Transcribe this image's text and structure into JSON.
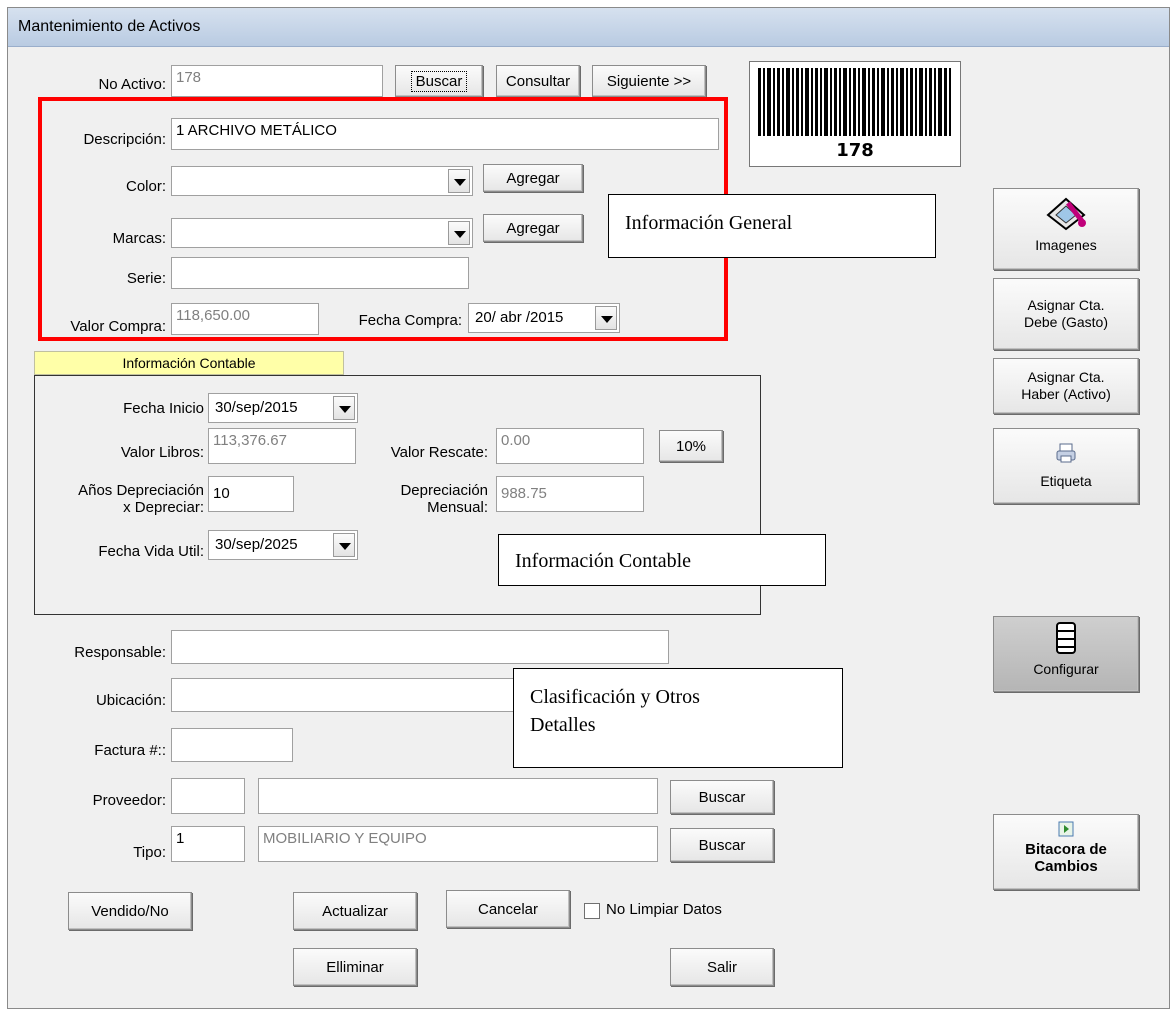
{
  "window": {
    "title": "Mantenimiento de Activos"
  },
  "header": {
    "no_activo_label": "No Activo:",
    "no_activo_value": "178",
    "buscar": "Buscar",
    "consultar": "Consultar",
    "siguiente": "Siguiente >>",
    "barcode_number": "178"
  },
  "general": {
    "descripcion_label": "Descripción:",
    "descripcion_value": "1 ARCHIVO METÁLICO",
    "color_label": "Color:",
    "color_value": "",
    "agregar_color": "Agregar",
    "marcas_label": "Marcas:",
    "marcas_value": "",
    "agregar_marcas": "Agregar",
    "serie_label": "Serie:",
    "serie_value": "",
    "valor_compra_label": "Valor Compra:",
    "valor_compra_value": "118,650.00",
    "fecha_compra_label": "Fecha Compra:",
    "fecha_compra_value": "20/ abr /2015",
    "callout": "Información General"
  },
  "contable": {
    "tab_label": "Información Contable",
    "fecha_inicio_label": "Fecha Inicio",
    "fecha_inicio_value": "30/sep/2015",
    "valor_libros_label": "Valor Libros:",
    "valor_libros_value": "113,376.67",
    "valor_rescate_label": "Valor Rescate:",
    "valor_rescate_value": "0.00",
    "pct_button": "10%",
    "anos_label_1": "Años Depreciación",
    "anos_label_2": "x Depreciar:",
    "anos_value": "10",
    "dep_mensual_label_1": "Depreciación",
    "dep_mensual_label_2": "Mensual:",
    "dep_mensual_value": "988.75",
    "fecha_vida_label": "Fecha Vida Util:",
    "fecha_vida_value": "30/sep/2025",
    "callout": "Información Contable"
  },
  "otros": {
    "responsable_label": "Responsable:",
    "responsable_value": "",
    "ubicacion_label": "Ubicación:",
    "ubicacion_value": "",
    "factura_label": "Factura #::",
    "factura_value": "",
    "proveedor_label": "Proveedor:",
    "proveedor_code": "",
    "proveedor_name": "",
    "proveedor_buscar": "Buscar",
    "tipo_label": "Tipo:",
    "tipo_code": "1",
    "tipo_name": "MOBILIARIO Y EQUIPO",
    "tipo_buscar": "Buscar",
    "callout_line1": "Clasificación y Otros",
    "callout_line2": "Detalles"
  },
  "sidebar": {
    "imagenes": "Imagenes",
    "debe_1": "Asignar Cta.",
    "debe_2": "Debe (Gasto)",
    "haber_1": "Asignar Cta.",
    "haber_2": "Haber (Activo)",
    "etiqueta": "Etiqueta",
    "configurar": "Configurar",
    "bitacora_1": "Bitacora de",
    "bitacora_2": "Cambios"
  },
  "footer": {
    "vendido": "Vendido/No",
    "actualizar": "Actualizar",
    "cancelar": "Cancelar",
    "no_limpiar": "No Limpiar Datos",
    "no_limpiar_checked": false,
    "eliminar": "Elliminar",
    "salir": "Salir"
  },
  "colors": {
    "highlight": "#ff0000",
    "tab_bg": "#ffffa8",
    "titlebar": "#c4d4ea"
  }
}
